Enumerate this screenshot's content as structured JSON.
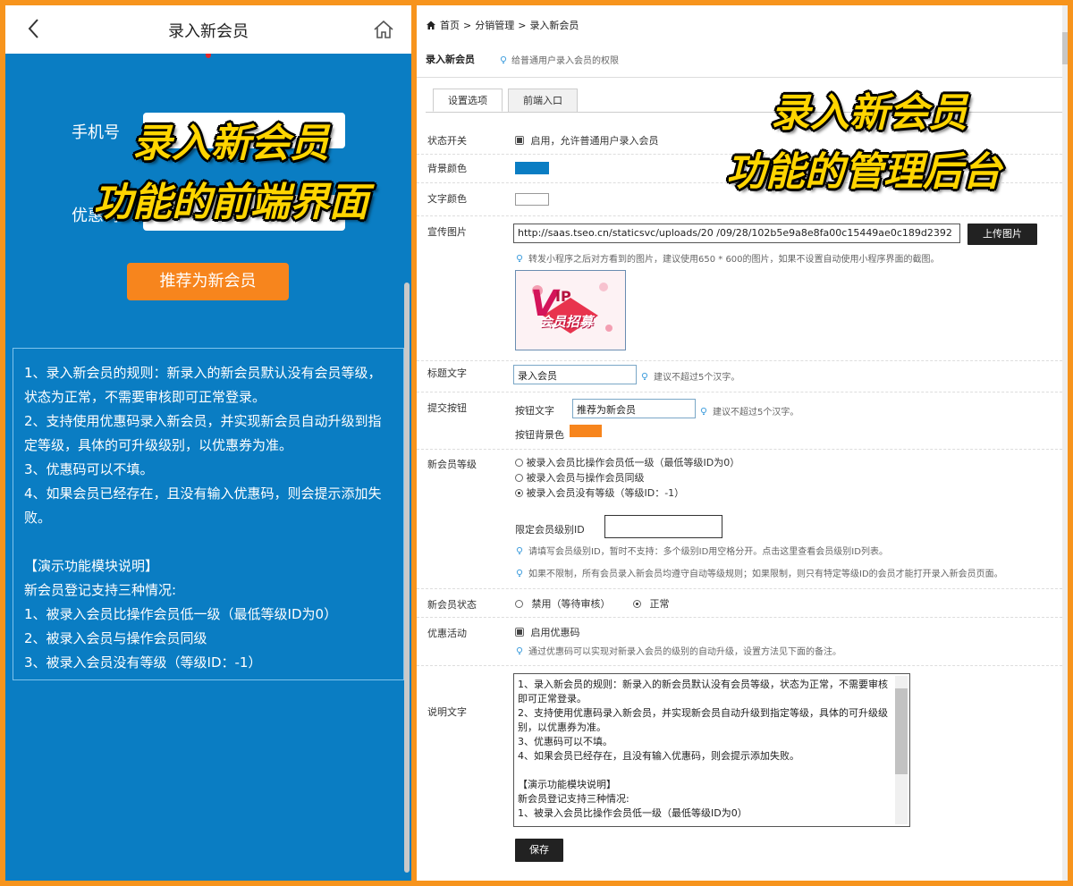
{
  "mobile": {
    "title": "录入新会员",
    "phone_label": "手机号",
    "coupon_label": "优惠码",
    "submit_label": "推荐为新会员",
    "rules": [
      "1、录入新会员的规则：新录入的新会员默认没有会员等级，状态为正常，不需要审核即可正常登录。",
      "2、支持使用优惠码录入新会员，并实现新会员自动升级到指定等级，具体的可升级级别，以优惠券为准。",
      "3、优惠码可以不填。",
      "4、如果会员已经存在，且没有输入优惠码，则会提示添加失败。",
      "",
      "【演示功能模块说明】",
      "新会员登记支持三种情况:",
      "1、被录入会员比操作会员低一级（最低等级ID为0）",
      "2、被录入会员与操作会员同级",
      "3、被录入会员没有等级（等级ID：-1）"
    ],
    "overlay_line1": "录入新会员",
    "overlay_line2": "功能的前端界面"
  },
  "admin": {
    "breadcrumb": [
      "首页",
      ">",
      "分销管理",
      ">",
      "录入新会员"
    ],
    "page_title": "录入新会员",
    "page_tip": "给普通用户录入会员的权限",
    "tabs": [
      "设置选项",
      "前端入口"
    ],
    "overlay_line1": "录入新会员",
    "overlay_line2": "功能的管理后台",
    "status_switch": {
      "label": "状态开关",
      "checkbox_text": "启用，允许普通用户录入会员",
      "checked": true
    },
    "bg_color": {
      "label": "背景颜色",
      "value": "#0a7dc3"
    },
    "text_color": {
      "label": "文字颜色",
      "value": "#ffffff"
    },
    "promo_image": {
      "label": "宣传图片",
      "url": "http://saas.tseo.cn/staticsvc/uploads/20   /09/28/102b5e9a8e8fa00c15449ae0c189d2392",
      "upload_button": "上传图片",
      "hint": "转发小程序之后对方看到的图片，建议使用650 * 600的图片，如果不设置自动使用小程序界面的截图。",
      "preview_text": "会员招募"
    },
    "title_text": {
      "label": "标题文字",
      "value": "录入会员",
      "hint": "建议不超过5个汉字。"
    },
    "submit_button": {
      "label": "提交按钮",
      "text_label": "按钮文字",
      "text_value": "推荐为新会员",
      "text_hint": "建议不超过5个汉字。",
      "bg_label": "按钮背景色",
      "bg_value": "#f7851d"
    },
    "member_level": {
      "label": "新会员等级",
      "options": [
        "被录入会员比操作会员低一级（最低等级ID为0）",
        "被录入会员与操作会员同级",
        "被录入会员没有等级（等级ID：-1）"
      ],
      "selected": 2,
      "limit_label": "限定会员级别ID",
      "limit_value": "",
      "hint1": "请填写会员级别ID，暂时不支持：多个级别ID用空格分开。点击这里查看会员级别ID列表。",
      "hint2": "如果不限制，所有会员录入新会员均遵守自动等级规则；如果限制，则只有特定等级ID的会员才能打开录入新会员页面。"
    },
    "member_status": {
      "label": "新会员状态",
      "options": [
        "禁用（等待审核）",
        "正常"
      ],
      "selected": 1
    },
    "promo": {
      "label": "优惠活动",
      "checkbox_text": "启用优惠码",
      "checked": true,
      "hint": "通过优惠码可以实现对新录入会员的级别的自动升级，设置方法见下面的备注。"
    },
    "description": {
      "label": "说明文字",
      "lines": [
        "1、录入新会员的规则：新录入的新会员默认没有会员等级，状态为正常，不需要审核即可正常登录。",
        "2、支持使用优惠码录入新会员，并实现新会员自动升级到指定等级，具体的可升级级别，以优惠券为准。",
        "3、优惠码可以不填。",
        "4、如果会员已经存在，且没有输入优惠码，则会提示添加失败。",
        "",
        "【演示功能模块说明】",
        "新会员登记支持三种情况:",
        "1、被录入会员比操作会员低一级（最低等级ID为0）"
      ]
    },
    "save_button": "保存"
  }
}
